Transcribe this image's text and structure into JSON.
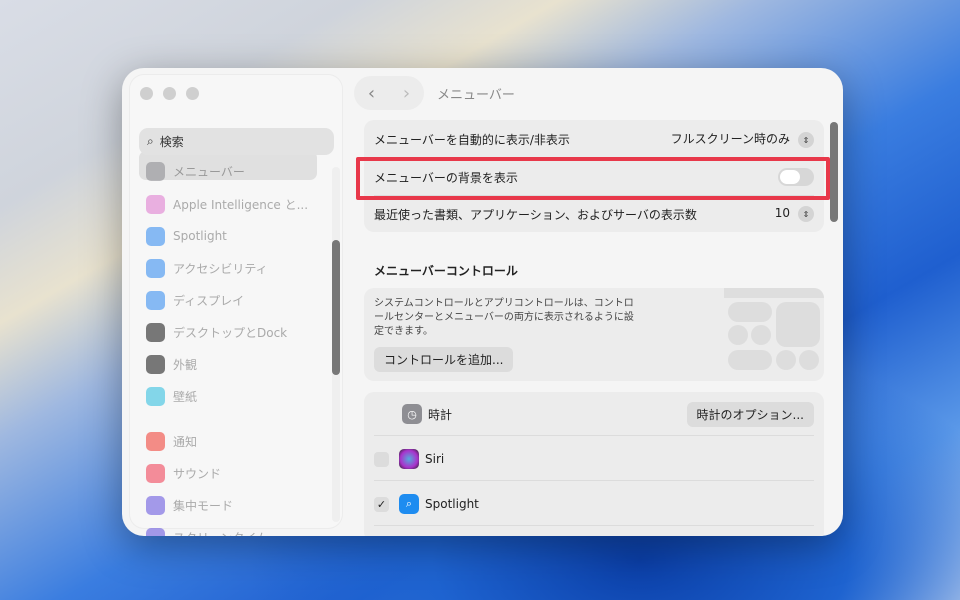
{
  "window": {
    "title": "メニューバー"
  },
  "sidebar": {
    "search_placeholder": "検索",
    "items": [
      {
        "label": "メニューバー",
        "icon": "menubar-icon",
        "color": "#8e8e93"
      },
      {
        "label": "Apple Intelligence と...",
        "icon": "apple-intelligence-icon",
        "color": "#e07fd0"
      },
      {
        "label": "Spotlight",
        "icon": "spotlight-icon",
        "color": "#3b8ff0"
      },
      {
        "label": "アクセシビリティ",
        "icon": "accessibility-icon",
        "color": "#3b8ff0"
      },
      {
        "label": "ディスプレイ",
        "icon": "display-icon",
        "color": "#3b8ff0"
      },
      {
        "label": "デスクトップとDock",
        "icon": "desktop-dock-icon",
        "color": "#222222"
      },
      {
        "label": "外観",
        "icon": "appearance-icon",
        "color": "#222222"
      },
      {
        "label": "壁紙",
        "icon": "wallpaper-icon",
        "color": "#35c0e0"
      },
      {
        "label": "通知",
        "icon": "notifications-icon",
        "color": "#f0443a"
      },
      {
        "label": "サウンド",
        "icon": "sound-icon",
        "color": "#f0445a"
      },
      {
        "label": "集中モード",
        "icon": "focus-icon",
        "color": "#6a5ae0"
      },
      {
        "label": "スクリーンタイム",
        "icon": "screen-time-icon",
        "color": "#6a5ae0"
      }
    ]
  },
  "settings": {
    "auto_hide": {
      "label": "メニューバーを自動的に表示/非表示",
      "value": "フルスクリーン時のみ"
    },
    "show_background": {
      "label": "メニューバーの背景を表示",
      "on": false
    },
    "recent": {
      "label": "最近使った書類、アプリケーション、およびサーバの表示数",
      "value": "10"
    }
  },
  "controls": {
    "heading": "メニューバーコントロール",
    "description": "システムコントロールとアプリコントロールは、コントロールセンターとメニューバーの両方に表示されるように設定できます。",
    "add_button": "コントロールを追加..."
  },
  "items": [
    {
      "label": "時計",
      "button": "時計のオプション...",
      "icon": "clock-icon"
    },
    {
      "label": "Siri",
      "checked": false,
      "icon": "siri-icon"
    },
    {
      "label": "Spotlight",
      "checked": true,
      "icon": "spotlight-icon",
      "check": "✓"
    }
  ]
}
